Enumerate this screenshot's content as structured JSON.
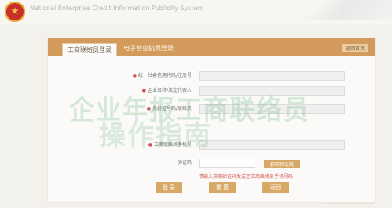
{
  "header": {
    "site_title": "National Enterprise Credit Information Publicity System"
  },
  "tabs": {
    "active": "工商联络员登录",
    "inactive": "电子营业执照登录"
  },
  "panel": {
    "return_home": "返回首页"
  },
  "form": {
    "rows": [
      {
        "label": "统一社会信用代码/注册号",
        "required": true
      },
      {
        "label": "企业名称/法定代表人",
        "required": true
      },
      {
        "label": "身份证号码/联络员",
        "required": true
      },
      {
        "label": "工商联络员手机号",
        "required": true
      },
      {
        "label": "验证码",
        "required": false
      }
    ],
    "captcha_button": "获取验证码",
    "captcha_tip": "请输入获取验证码发送至工商联络员手机号码"
  },
  "overlay": {
    "line1": "企业年报工商联络员",
    "line2": "操作指南"
  },
  "buttons": {
    "login": "登 录",
    "reset": "重 置",
    "back": "返回"
  },
  "colors": {
    "accent": "#d29a5b",
    "button": "#d8a867",
    "warning": "#d0554e",
    "overlay": "#2d9746"
  }
}
